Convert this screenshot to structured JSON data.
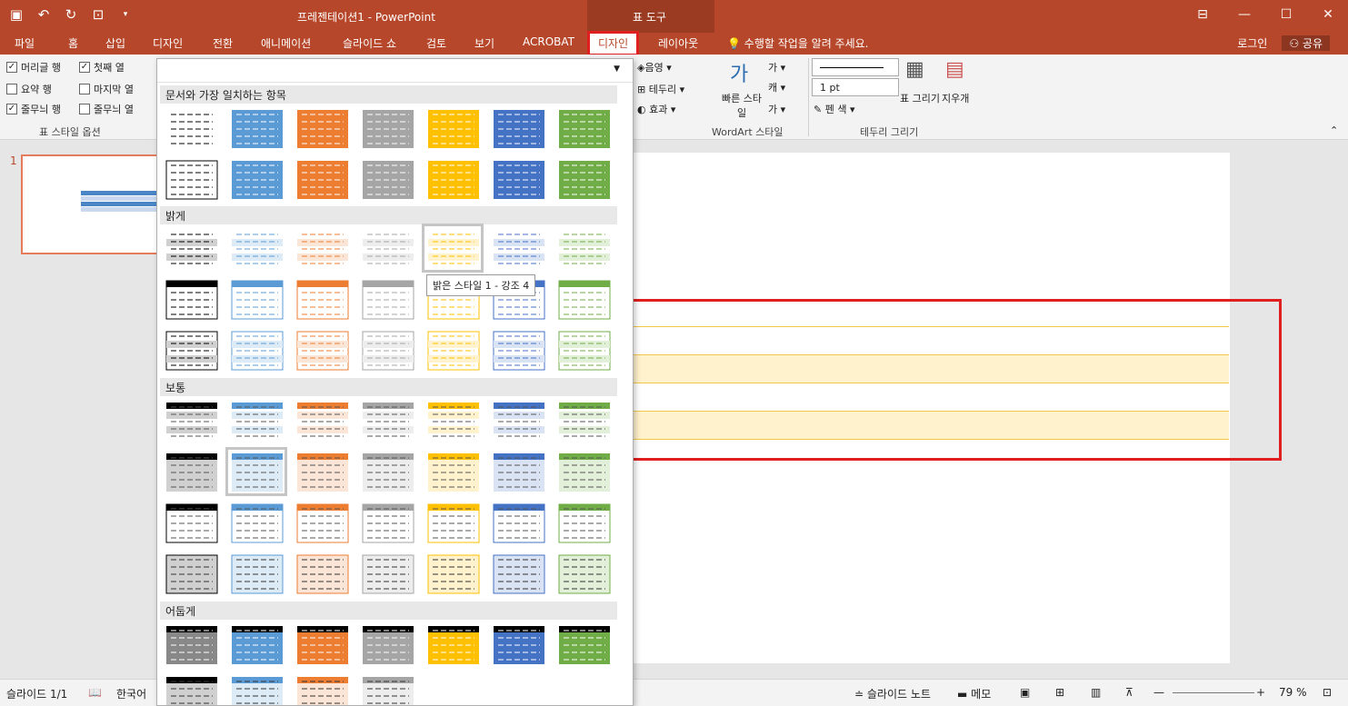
{
  "app": {
    "title": "프레젠테이션1 - PowerPoint",
    "context_group": "표 도구"
  },
  "colors": {
    "ribbon": "#b7472a",
    "accent_highlight": "#e02020",
    "table_band": "#fff2cc",
    "table_border": "#f2c848"
  },
  "qat": [
    "save-icon",
    "undo-icon",
    "redo-icon",
    "present-icon",
    "customize-icon"
  ],
  "tabs": [
    "파일",
    "홈",
    "삽입",
    "디자인",
    "전환",
    "애니메이션",
    "슬라이드 쇼",
    "검토",
    "보기",
    "ACROBAT",
    "디자인",
    "레이아웃"
  ],
  "tell_me": "수행할 작업을 알려 주세요.",
  "account": {
    "signin": "로그인",
    "share": "공유"
  },
  "ribbon": {
    "options": {
      "header_row": "머리글 행",
      "first_col": "첫째 열",
      "total_row": "요약 행",
      "last_col": "마지막 열",
      "banded_rows": "줄무늬 행",
      "banded_cols": "줄무늬 열",
      "group_label": "표 스타일 옵션"
    },
    "shading": "음영",
    "borders": "테두리",
    "effects": "효과",
    "quick_styles": "빠른 스타일",
    "wordart_label": "WordArt 스타일",
    "pen_weight": "1 pt",
    "pen_color": "펜 색",
    "draw_table": "표 그리기",
    "eraser": "지우개",
    "draw_borders_label": "테두리 그리기"
  },
  "thumbs": {
    "num": "1"
  },
  "gallery": {
    "sections": [
      "문서와 가장 일치하는 항목",
      "밝게",
      "보통",
      "어둡게"
    ],
    "tooltip": "밝은 스타일 1 - 강조 4"
  },
  "status": {
    "slide": "슬라이드 1/1",
    "lang": "한국어",
    "notes": "슬라이드 노트",
    "comments": "메모",
    "zoom": "79 %"
  }
}
